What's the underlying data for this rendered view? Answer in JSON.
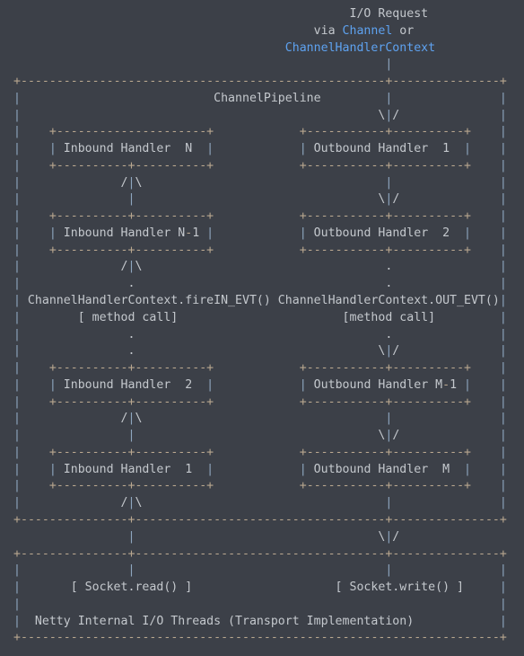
{
  "header": {
    "io_request": "I/O Request",
    "via": "via",
    "channel": "Channel",
    "or": "or",
    "context": "ChannelHandlerContext"
  },
  "colors": {
    "background": "#3c4048",
    "text": "#c4c8cd",
    "highlight": "#5ea2f0",
    "border": "#b9a78f",
    "pipe": "#8ea6bf"
  },
  "lines": [
    "                                                    |",
    "+---------------------------------------------------+---------------+",
    "|                           ChannelPipeline         |               |",
    "|                                                  \\|/              |",
    "|    +---------------------+            +-----------+----------+    |",
    "|    | Inbound Handler  N  |            | Outbound Handler  1  |    |",
    "|    +----------+----------+            +-----------+----------+    |",
    "|              /|\\                                  |               |",
    "|               |                                  \\|/              |",
    "|    +----------+----------+            +-----------+----------+    |",
    "|    | Inbound Handler N-1 |            | Outbound Handler  2  |    |",
    "|    +----------+----------+            +-----------+----------+    |",
    "|              /|\\                                  .               |",
    "|               .                                   .               |",
    "| ChannelHandlerContext.fireIN_EVT() ChannelHandlerContext.OUT_EVT()|",
    "|        [ method call]                       [method call]         |",
    "|               .                                   .               |",
    "|               .                                  \\|/              |",
    "|    +----------+----------+            +-----------+----------+    |",
    "|    | Inbound Handler  2  |            | Outbound Handler M-1 |    |",
    "|    +----------+----------+            +-----------+----------+    |",
    "|              /|\\                                  |               |",
    "|               |                                  \\|/              |",
    "|    +----------+----------+            +-----------+----------+    |",
    "|    | Inbound Handler  1  |            | Outbound Handler  M  |    |",
    "|    +----------+----------+            +-----------+----------+    |",
    "|              /|\\                                  |               |",
    "+---------------+-----------------------------------+---------------+",
    "                |                                  \\|/",
    "+---------------+-----------------------------------+---------------+",
    "|               |                                   |               |",
    "|       [ Socket.read() ]                    [ Socket.write() ]     |",
    "|                                                                   |",
    "|  Netty Internal I/O Threads (Transport Implementation)            |",
    "+-------------------------------------------------------------------+"
  ]
}
